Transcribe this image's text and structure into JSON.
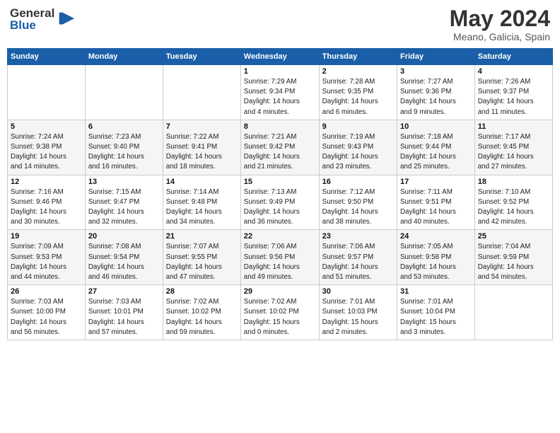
{
  "logo": {
    "general": "General",
    "blue": "Blue"
  },
  "title": "May 2024",
  "subtitle": "Meano, Galicia, Spain",
  "headers": [
    "Sunday",
    "Monday",
    "Tuesday",
    "Wednesday",
    "Thursday",
    "Friday",
    "Saturday"
  ],
  "weeks": [
    [
      {
        "num": "",
        "info": ""
      },
      {
        "num": "",
        "info": ""
      },
      {
        "num": "",
        "info": ""
      },
      {
        "num": "1",
        "info": "Sunrise: 7:29 AM\nSunset: 9:34 PM\nDaylight: 14 hours\nand 4 minutes."
      },
      {
        "num": "2",
        "info": "Sunrise: 7:28 AM\nSunset: 9:35 PM\nDaylight: 14 hours\nand 6 minutes."
      },
      {
        "num": "3",
        "info": "Sunrise: 7:27 AM\nSunset: 9:36 PM\nDaylight: 14 hours\nand 9 minutes."
      },
      {
        "num": "4",
        "info": "Sunrise: 7:26 AM\nSunset: 9:37 PM\nDaylight: 14 hours\nand 11 minutes."
      }
    ],
    [
      {
        "num": "5",
        "info": "Sunrise: 7:24 AM\nSunset: 9:38 PM\nDaylight: 14 hours\nand 14 minutes."
      },
      {
        "num": "6",
        "info": "Sunrise: 7:23 AM\nSunset: 9:40 PM\nDaylight: 14 hours\nand 16 minutes."
      },
      {
        "num": "7",
        "info": "Sunrise: 7:22 AM\nSunset: 9:41 PM\nDaylight: 14 hours\nand 18 minutes."
      },
      {
        "num": "8",
        "info": "Sunrise: 7:21 AM\nSunset: 9:42 PM\nDaylight: 14 hours\nand 21 minutes."
      },
      {
        "num": "9",
        "info": "Sunrise: 7:19 AM\nSunset: 9:43 PM\nDaylight: 14 hours\nand 23 minutes."
      },
      {
        "num": "10",
        "info": "Sunrise: 7:18 AM\nSunset: 9:44 PM\nDaylight: 14 hours\nand 25 minutes."
      },
      {
        "num": "11",
        "info": "Sunrise: 7:17 AM\nSunset: 9:45 PM\nDaylight: 14 hours\nand 27 minutes."
      }
    ],
    [
      {
        "num": "12",
        "info": "Sunrise: 7:16 AM\nSunset: 9:46 PM\nDaylight: 14 hours\nand 30 minutes."
      },
      {
        "num": "13",
        "info": "Sunrise: 7:15 AM\nSunset: 9:47 PM\nDaylight: 14 hours\nand 32 minutes."
      },
      {
        "num": "14",
        "info": "Sunrise: 7:14 AM\nSunset: 9:48 PM\nDaylight: 14 hours\nand 34 minutes."
      },
      {
        "num": "15",
        "info": "Sunrise: 7:13 AM\nSunset: 9:49 PM\nDaylight: 14 hours\nand 36 minutes."
      },
      {
        "num": "16",
        "info": "Sunrise: 7:12 AM\nSunset: 9:50 PM\nDaylight: 14 hours\nand 38 minutes."
      },
      {
        "num": "17",
        "info": "Sunrise: 7:11 AM\nSunset: 9:51 PM\nDaylight: 14 hours\nand 40 minutes."
      },
      {
        "num": "18",
        "info": "Sunrise: 7:10 AM\nSunset: 9:52 PM\nDaylight: 14 hours\nand 42 minutes."
      }
    ],
    [
      {
        "num": "19",
        "info": "Sunrise: 7:09 AM\nSunset: 9:53 PM\nDaylight: 14 hours\nand 44 minutes."
      },
      {
        "num": "20",
        "info": "Sunrise: 7:08 AM\nSunset: 9:54 PM\nDaylight: 14 hours\nand 46 minutes."
      },
      {
        "num": "21",
        "info": "Sunrise: 7:07 AM\nSunset: 9:55 PM\nDaylight: 14 hours\nand 47 minutes."
      },
      {
        "num": "22",
        "info": "Sunrise: 7:06 AM\nSunset: 9:56 PM\nDaylight: 14 hours\nand 49 minutes."
      },
      {
        "num": "23",
        "info": "Sunrise: 7:06 AM\nSunset: 9:57 PM\nDaylight: 14 hours\nand 51 minutes."
      },
      {
        "num": "24",
        "info": "Sunrise: 7:05 AM\nSunset: 9:58 PM\nDaylight: 14 hours\nand 53 minutes."
      },
      {
        "num": "25",
        "info": "Sunrise: 7:04 AM\nSunset: 9:59 PM\nDaylight: 14 hours\nand 54 minutes."
      }
    ],
    [
      {
        "num": "26",
        "info": "Sunrise: 7:03 AM\nSunset: 10:00 PM\nDaylight: 14 hours\nand 56 minutes."
      },
      {
        "num": "27",
        "info": "Sunrise: 7:03 AM\nSunset: 10:01 PM\nDaylight: 14 hours\nand 57 minutes."
      },
      {
        "num": "28",
        "info": "Sunrise: 7:02 AM\nSunset: 10:02 PM\nDaylight: 14 hours\nand 59 minutes."
      },
      {
        "num": "29",
        "info": "Sunrise: 7:02 AM\nSunset: 10:02 PM\nDaylight: 15 hours\nand 0 minutes."
      },
      {
        "num": "30",
        "info": "Sunrise: 7:01 AM\nSunset: 10:03 PM\nDaylight: 15 hours\nand 2 minutes."
      },
      {
        "num": "31",
        "info": "Sunrise: 7:01 AM\nSunset: 10:04 PM\nDaylight: 15 hours\nand 3 minutes."
      },
      {
        "num": "",
        "info": ""
      }
    ]
  ]
}
